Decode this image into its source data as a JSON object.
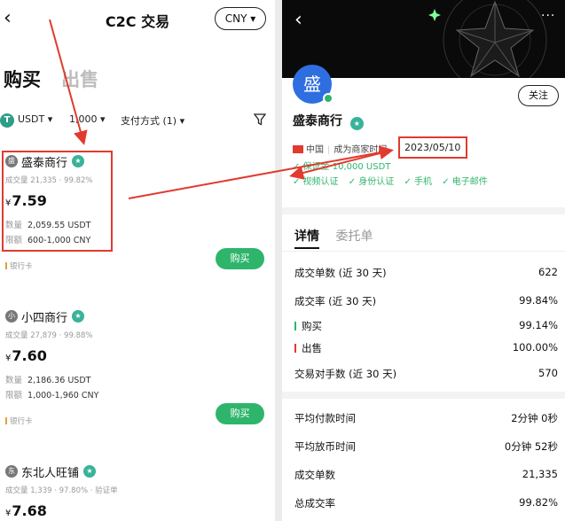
{
  "left": {
    "back_glyph": "‹",
    "title": "C2C 交易",
    "currency": "CNY ▾",
    "tab_buy": "购买",
    "tab_sell": "出售",
    "filters": {
      "coin_icon": "T",
      "coin": "USDT ▾",
      "amount": "1,000 ▾",
      "pay_method": "支付方式 (1) ▾"
    },
    "merchants": [
      {
        "avatar": "盛",
        "name": "盛泰商行",
        "stats": "成交量 21,335 · 99.82%",
        "currency_symbol": "¥",
        "price": "7.59",
        "qty_label": "数量",
        "qty": "2,059.55 USDT",
        "limit_label": "限额",
        "limit": "600-1,000 CNY",
        "payment": "银行卡",
        "buy": "购买"
      },
      {
        "avatar": "小",
        "name": "小四商行",
        "stats": "成交量 27,879 · 99.88%",
        "currency_symbol": "¥",
        "price": "7.60",
        "qty_label": "数量",
        "qty": "2,186.36 USDT",
        "limit_label": "限额",
        "limit": "1,000-1,960 CNY",
        "payment": "银行卡",
        "buy": "购买"
      },
      {
        "avatar": "东",
        "name": "东北人旺铺",
        "stats": "成交量 1,339 · 97.80% · 验证单",
        "currency_symbol": "¥",
        "price": "7.68"
      }
    ]
  },
  "right": {
    "back_glyph": "‹",
    "more_glyph": "···",
    "avatar": "盛",
    "follow": "关注",
    "name": "盛泰商行",
    "country": "中国",
    "merchant_since_label": "成为商家时间",
    "merchant_since": "2023/05/10",
    "margin": "✓ 保证金 10,000 USDT",
    "verifications": [
      "✓ 视频认证",
      "✓ 身份认证",
      "✓ 手机",
      "✓ 电子邮件"
    ],
    "tab_details": "详情",
    "tab_orders": "委托单",
    "stats": [
      {
        "label": "成交单数 (近 30 天)",
        "value": "622"
      },
      {
        "label": "成交率 (近 30 天)",
        "value": "99.84%"
      },
      {
        "label": "购买",
        "value": "99.14%"
      },
      {
        "label": "出售",
        "value": "100.00%"
      },
      {
        "label": "交易对手数 (近 30 天)",
        "value": "570"
      },
      {
        "label": "平均付款时间",
        "value": "2分钟 0秒"
      },
      {
        "label": "平均放币时间",
        "value": "0分钟 52秒"
      },
      {
        "label": "成交单数",
        "value": "21,335"
      },
      {
        "label": "总成交率",
        "value": "99.82%"
      }
    ]
  },
  "colors": {
    "accent_green": "#2fb56b",
    "highlight_red": "#e23a2f",
    "badge_teal": "#38b39a",
    "avatar_blue": "#2f6ee0"
  }
}
